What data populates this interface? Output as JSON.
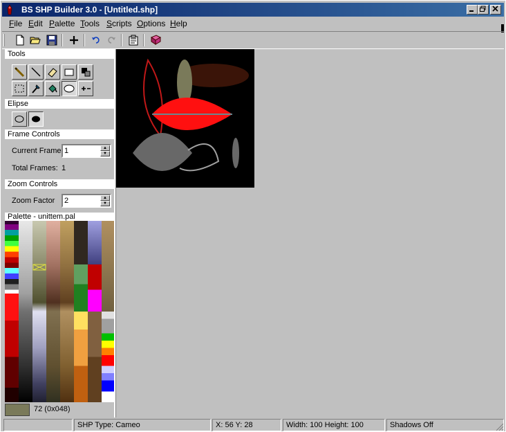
{
  "window": {
    "title": "BS SHP Builder 3.0 - [Untitled.shp]",
    "minimize_label": "_",
    "restore_label": "▫",
    "close_label": "✕"
  },
  "menu": [
    "File",
    "Edit",
    "Palette",
    "Tools",
    "Scripts",
    "Options",
    "Help"
  ],
  "menu_accel": [
    "F",
    "E",
    "P",
    "T",
    "S",
    "O",
    "H"
  ],
  "toolbar_icons": [
    "new-file-icon",
    "open-folder-icon",
    "save-disk-icon",
    "add-frame-icon",
    "undo-icon",
    "redo-icon",
    "properties-icon",
    "book-icon"
  ],
  "panels": {
    "tools": {
      "header": "Tools"
    },
    "ellipse": {
      "header": "Elipse"
    },
    "frame_controls": {
      "header": "Frame Controls",
      "current_frame_label": "Current Frame",
      "current_frame_value": "1",
      "total_frames_label": "Total Frames:",
      "total_frames_value": "1"
    },
    "zoom_controls": {
      "header": "Zoom Controls",
      "zoom_factor_label": "Zoom Factor",
      "zoom_factor_value": "2"
    },
    "palette": {
      "header": "Palette - unittem.pal",
      "selected_label": "72 (0x048)",
      "selected_color": "#7a7a5a"
    }
  },
  "status": {
    "empty": "",
    "shp_type": "SHP Type: Cameo",
    "coords": "X: 56 Y: 28",
    "size": "Width: 100 Height: 100",
    "shadows": "Shadows Off"
  },
  "canvas": {
    "background": "#000000",
    "colors": {
      "red": "#ff1010",
      "darkred": "#c01818",
      "gray": "#686868",
      "khaki": "#7a7a5a",
      "brown": "#3a1408",
      "light": "#a0a0a0",
      "teal": "#4b6e78"
    }
  }
}
